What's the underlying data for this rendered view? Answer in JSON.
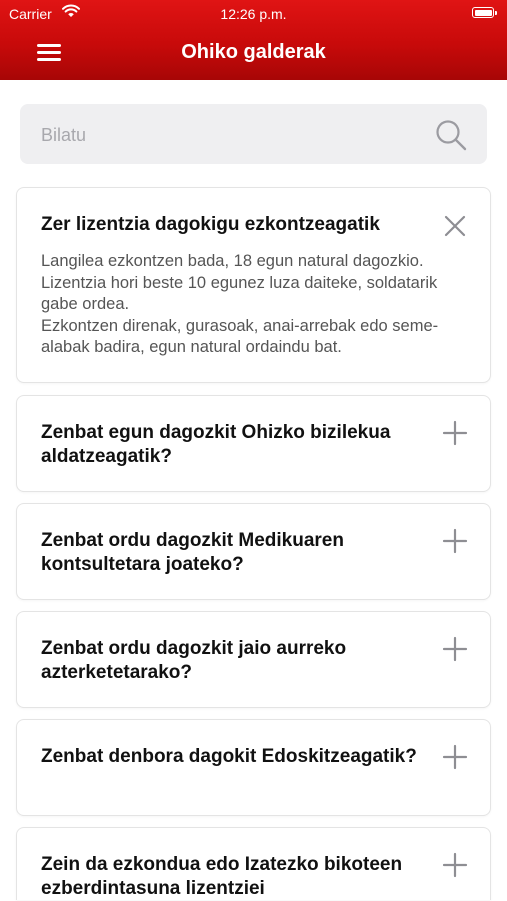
{
  "status_bar": {
    "carrier": "Carrier",
    "time": "12:26 p.m."
  },
  "header": {
    "title": "Ohiko galderak",
    "menu_icon": "hamburger-menu-icon",
    "background_color": "#c80a0a"
  },
  "search": {
    "placeholder": "Bilatu",
    "value": "",
    "icon": "search-icon"
  },
  "faq": {
    "items": [
      {
        "question": "Zer lizentzia dagokigu ezkontzeagatik",
        "answer": "Langilea ezkontzen bada, 18 egun natural dagozkio. Lizentzia hori beste 10 egunez luza daiteke, soldatarik gabe ordea.\nEzkontzen direnak, gurasoak, anai-arrebak edo seme-alabak badira, egun natural ordaindu bat.",
        "expanded": true,
        "toggle_icon": "close-icon"
      },
      {
        "question": "Zenbat egun dagozkit Ohizko bizilekua aldatzeagatik?",
        "expanded": false,
        "toggle_icon": "plus-icon"
      },
      {
        "question": "Zenbat ordu dagozkit Medikuaren kontsultetara joateko?",
        "expanded": false,
        "toggle_icon": "plus-icon"
      },
      {
        "question": "Zenbat ordu dagozkit  jaio aurreko azterketetarako?",
        "expanded": false,
        "toggle_icon": "plus-icon"
      },
      {
        "question": "Zenbat denbora dagokit Edoskitzeagatik?",
        "expanded": false,
        "toggle_icon": "plus-icon"
      },
      {
        "question": "Zein da ezkondua edo Izatezko bikoteen ezberdintasuna lizentziei",
        "expanded": false,
        "toggle_icon": "plus-icon"
      }
    ]
  }
}
